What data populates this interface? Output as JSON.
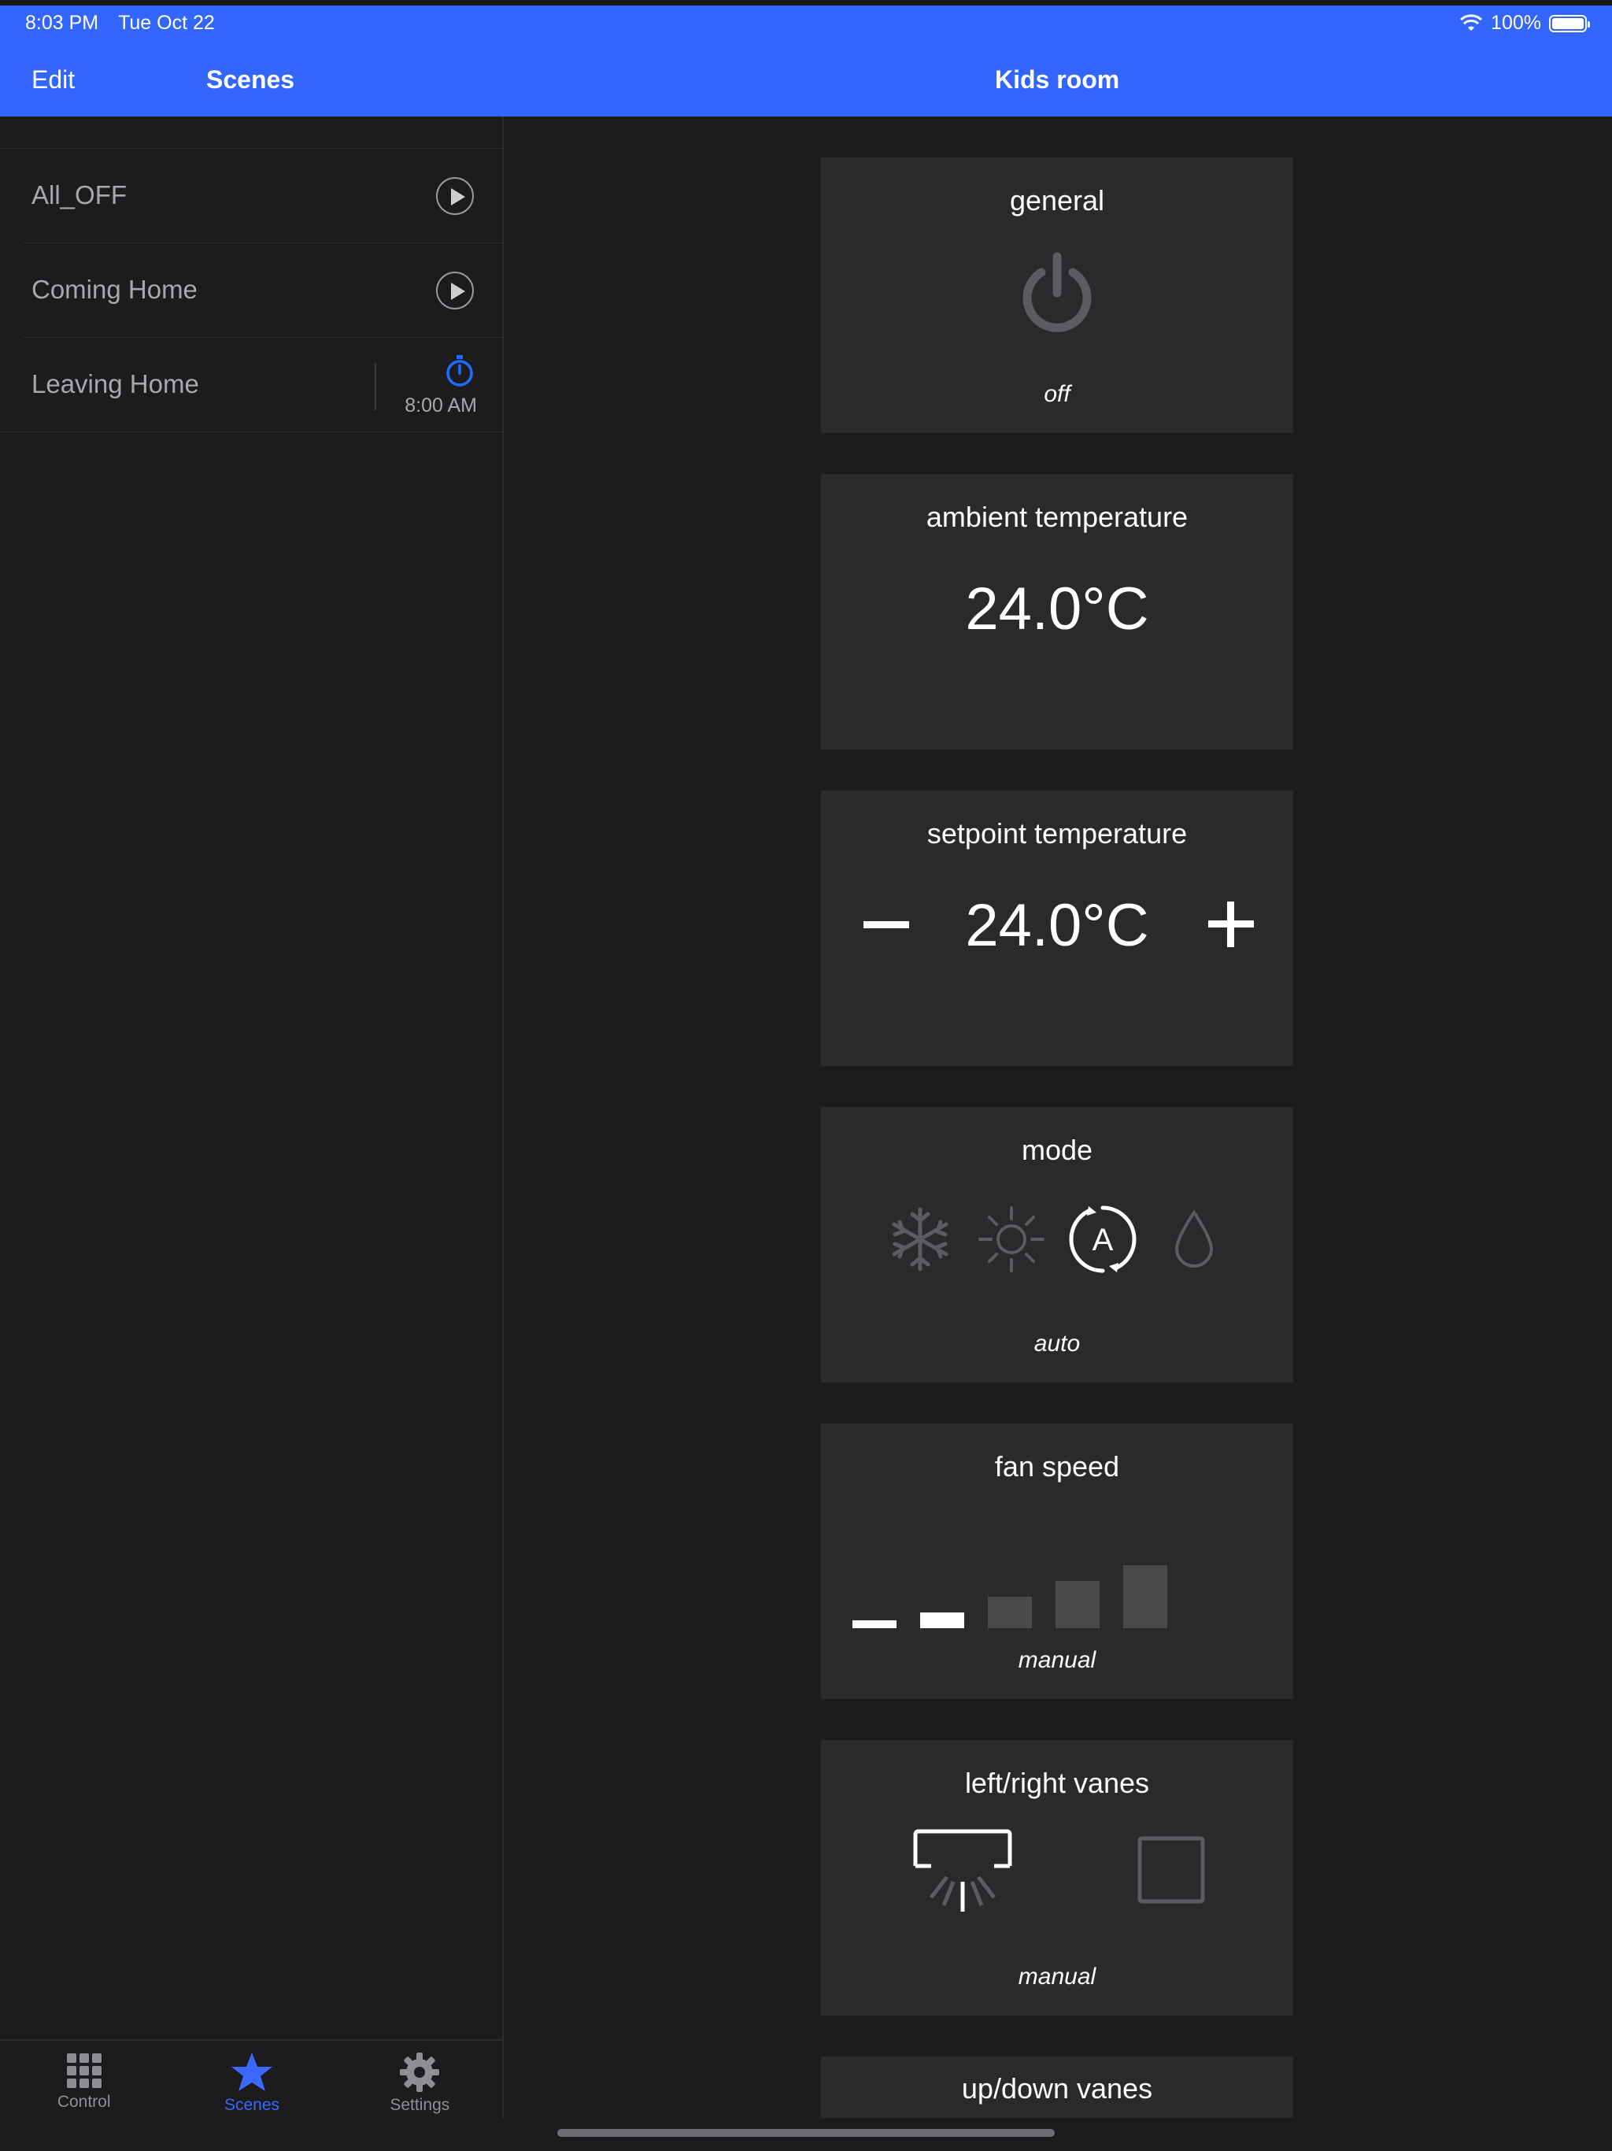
{
  "status_bar": {
    "time": "8:03 PM",
    "date": "Tue Oct 22",
    "battery": "100%"
  },
  "header": {
    "edit_label": "Edit",
    "scenes_title": "Scenes",
    "room_title": "Kids room"
  },
  "scenes": {
    "items": [
      {
        "label": "All_OFF",
        "action_icon": "play-icon"
      },
      {
        "label": "Coming Home",
        "action_icon": "play-icon"
      },
      {
        "label": "Leaving Home",
        "action_icon": "timer-icon",
        "time": "8:00 AM"
      }
    ]
  },
  "tabbar": {
    "items": [
      {
        "label": "Control",
        "icon": "grid-icon"
      },
      {
        "label": "Scenes",
        "icon": "star-icon"
      },
      {
        "label": "Settings",
        "icon": "gear-icon"
      }
    ],
    "active": "Scenes"
  },
  "cards": {
    "general": {
      "title": "general",
      "status": "off",
      "icon": "power-icon"
    },
    "ambient": {
      "title": "ambient temperature",
      "value": "24.0°C"
    },
    "setpoint": {
      "title": "setpoint temperature",
      "value": "24.0°C"
    },
    "mode": {
      "title": "mode",
      "status": "auto",
      "options": [
        "cool",
        "heat",
        "auto",
        "dry"
      ],
      "selected": "auto"
    },
    "fan_speed": {
      "title": "fan speed",
      "status": "manual",
      "levels": 5,
      "active_levels": 2
    },
    "lr_vanes": {
      "title": "left/right vanes",
      "status": "manual"
    },
    "ud_vanes": {
      "title": "up/down vanes"
    }
  },
  "colors": {
    "accent": "#3366ff",
    "background": "#1c1c1e",
    "card": "#2a2a2c",
    "timer_blue": "#1e6cff"
  }
}
